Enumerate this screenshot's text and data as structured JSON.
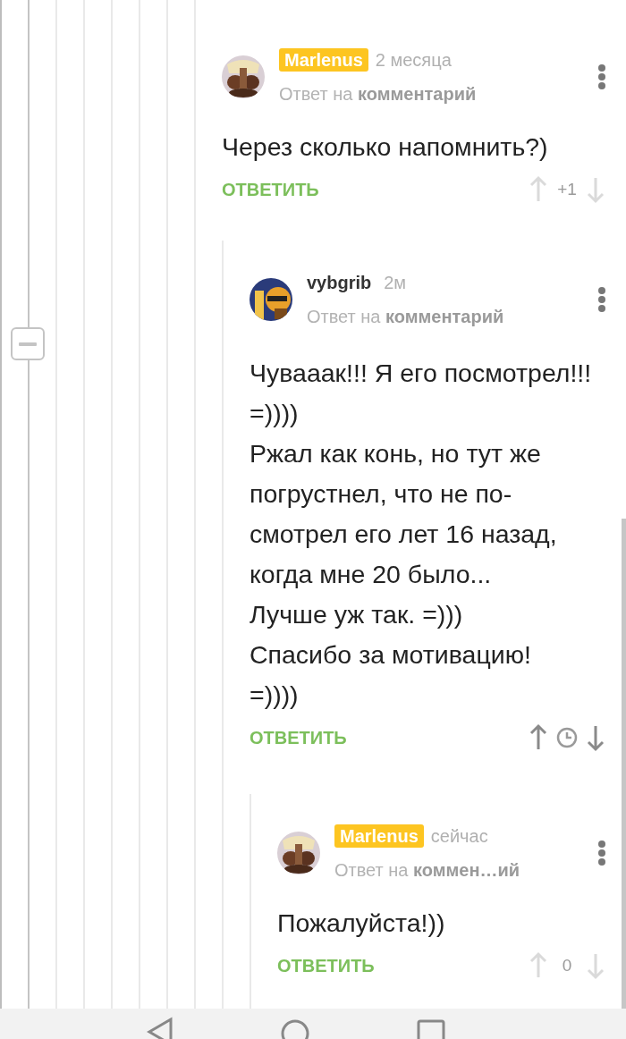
{
  "comments": [
    {
      "author": "Marlenus",
      "is_post_author": true,
      "time": "2 месяца",
      "reply_to": "Ответ на **комментарий**",
      "body": "Через сколько напомнить?)",
      "reply_label": "ОТВЕТИТЬ",
      "rating": {
        "kind": "score",
        "score": "+1",
        "active": false
      }
    },
    {
      "author": "vybgrib",
      "is_post_author": false,
      "time": "2м",
      "reply_to": "Ответ на **комментарий**",
      "body": "Чувааак!!! Я его посмотрел!!! =))))\nРжал как конь, но тут же погрустнел, что не по-смотрел его лет 16 назад, когда мне 20 было...\nЛучше уж так. =)))\nСпасибо за мотивацию!\n=))))",
      "reply_label": "ОТВЕТИТЬ",
      "rating": {
        "kind": "pending",
        "active": true
      }
    },
    {
      "author": "Marlenus",
      "is_post_author": true,
      "time": "сейчас",
      "reply_to": "Ответ на **коммен…ий**",
      "body": "Пожалуйста!))",
      "reply_label": "ОТВЕТИТЬ",
      "rating": {
        "kind": "score",
        "score": "0",
        "active": false
      }
    }
  ]
}
